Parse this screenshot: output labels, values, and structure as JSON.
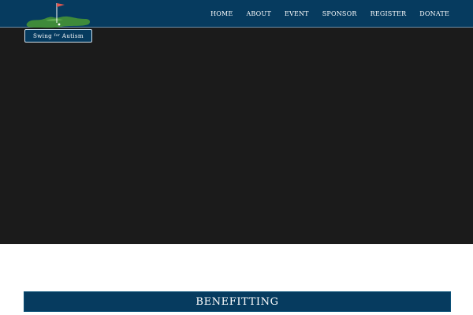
{
  "logo": {
    "line1": "Swing",
    "line2": "for",
    "line3": "Autism",
    "icon": "golf-flag-icon"
  },
  "nav": {
    "items": [
      {
        "label": "HOME"
      },
      {
        "label": "ABOUT"
      },
      {
        "label": "EVENT"
      },
      {
        "label": "SPONSOR"
      },
      {
        "label": "REGISTER"
      },
      {
        "label": "DONATE"
      }
    ]
  },
  "section": {
    "heading": "BENEFITTING"
  },
  "colors": {
    "header_bg": "#063b5f",
    "hero_bg": "#1b1b1b",
    "grass": "#3f8a3a",
    "flag": "#e0564f"
  }
}
